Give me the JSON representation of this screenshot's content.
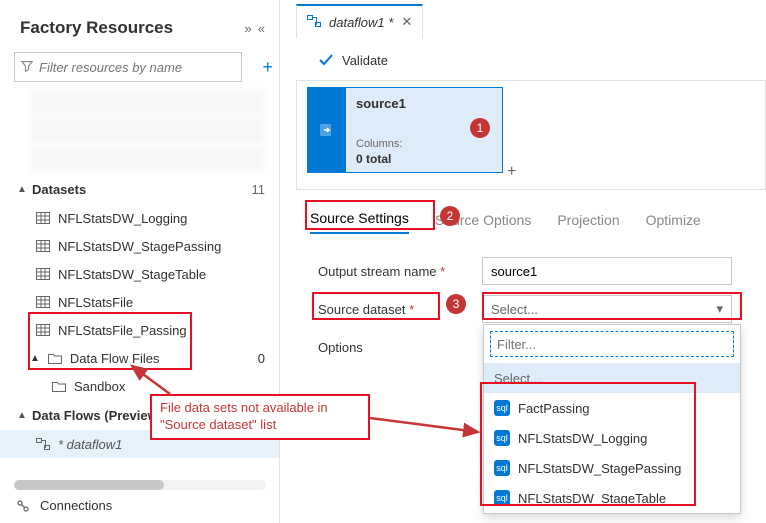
{
  "sidebar": {
    "title": "Factory Resources",
    "search_placeholder": "Filter resources by name",
    "groups": {
      "datasets": {
        "label": "Datasets",
        "count": "11"
      },
      "dataflowfiles": {
        "label": "Data Flow Files",
        "count": "0"
      },
      "sandbox": {
        "label": "Sandbox"
      },
      "dataflows": {
        "label": "Data Flows (Preview)"
      }
    },
    "items": {
      "logging": "NFLStatsDW_Logging",
      "stagepassing": "NFLStatsDW_StagePassing",
      "stagetable": "NFLStatsDW_StageTable",
      "statsfile": "NFLStatsFile",
      "statsfile_passing": "NFLStatsFile_Passing",
      "dataflow1": "* dataflow1"
    },
    "connections": "Connections"
  },
  "tabs": {
    "dataflow1": "dataflow1 *"
  },
  "toolbar": {
    "validate": "Validate"
  },
  "node": {
    "title": "source1",
    "cols_label": "Columns:",
    "cols_value": "0 total",
    "badge": "1"
  },
  "settings_tabs": {
    "source_settings": "Source Settings",
    "source_options": "Source Options",
    "projection": "Projection",
    "optimize": "Optimize",
    "badge": "2"
  },
  "form": {
    "output_stream_label": "Output stream name",
    "output_stream_value": "source1",
    "source_dataset_label": "Source dataset",
    "source_dataset_badge": "3",
    "select_placeholder": "Select...",
    "options_label": "Options"
  },
  "dropdown": {
    "filter_placeholder": "Filter...",
    "select_label": "Select...",
    "items": [
      "FactPassing",
      "NFLStatsDW_Logging",
      "NFLStatsDW_StagePassing",
      "NFLStatsDW_StageTable"
    ]
  },
  "callout": {
    "text": "File data sets not available in \"Source dataset\" list"
  }
}
